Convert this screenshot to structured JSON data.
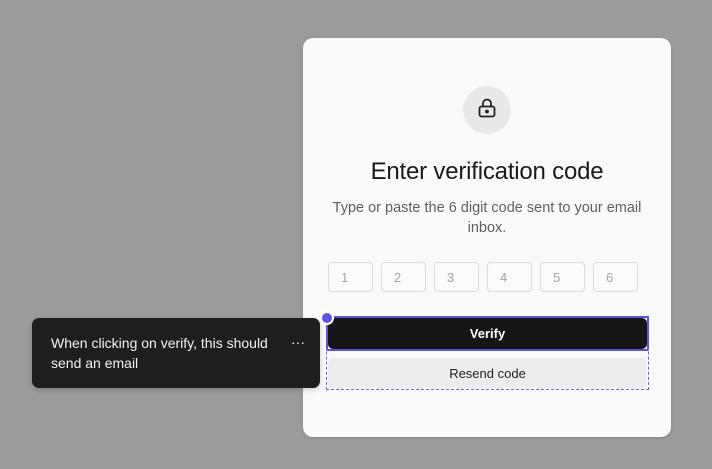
{
  "verification": {
    "title": "Enter verification code",
    "subtitle": "Type or paste the 6 digit code sent to your email inbox.",
    "code_placeholders": [
      "1",
      "2",
      "3",
      "4",
      "5",
      "6"
    ],
    "verify_label": "Verify",
    "resend_label": "Resend code"
  },
  "comment": {
    "text": "When clicking on verify, this should send an email",
    "more_label": "···"
  },
  "icons": {
    "lock": "lock-icon",
    "more": "more-horizontal-icon"
  },
  "colors": {
    "background": "#9b9b9b",
    "card": "#fafafa",
    "primary_button": "#161616",
    "selection_accent": "#5a52e0",
    "comment_bg": "#1e1e1e"
  }
}
